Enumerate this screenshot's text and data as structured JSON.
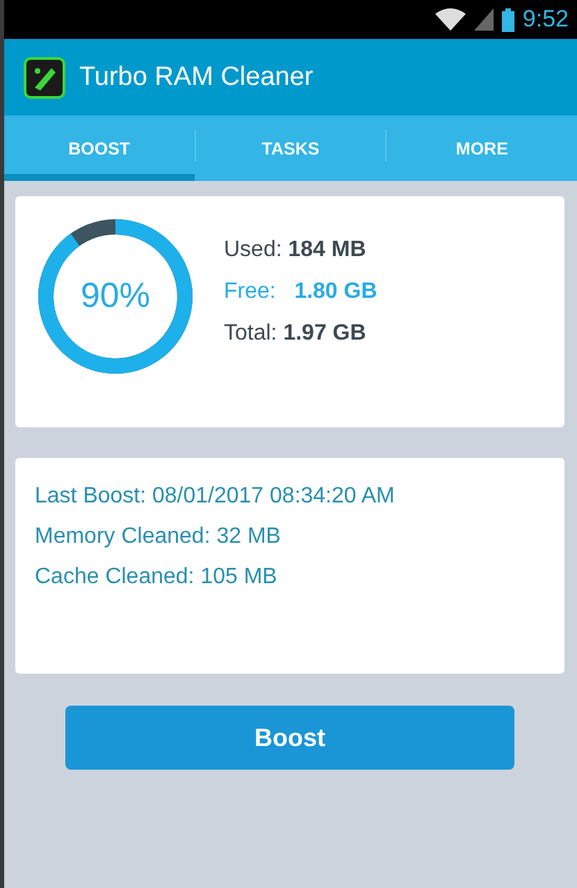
{
  "status_bar": {
    "time": "9:52"
  },
  "app_bar": {
    "title": "Turbo RAM Cleaner"
  },
  "tabs": [
    {
      "label": "BOOST",
      "selected": true
    },
    {
      "label": "TASKS",
      "selected": false
    },
    {
      "label": "MORE",
      "selected": false
    }
  ],
  "memory": {
    "gauge": {
      "reading": "90%"
    },
    "stats": [
      {
        "label": "Used:",
        "value": "184 MB",
        "color": "#3d4a52"
      },
      {
        "label": "Free:",
        "value": "1.80 GB",
        "color": "#29abe2"
      },
      {
        "label": "Total:",
        "value": "1.97 GB",
        "color": "#3d4a52"
      }
    ]
  },
  "history": [
    "Last Boost: 08/01/2017 08:34:20 AM",
    "Memory Cleaned: 32 MB",
    "Cache Cleaned: 105 MB"
  ],
  "boost_button": "Boost"
}
